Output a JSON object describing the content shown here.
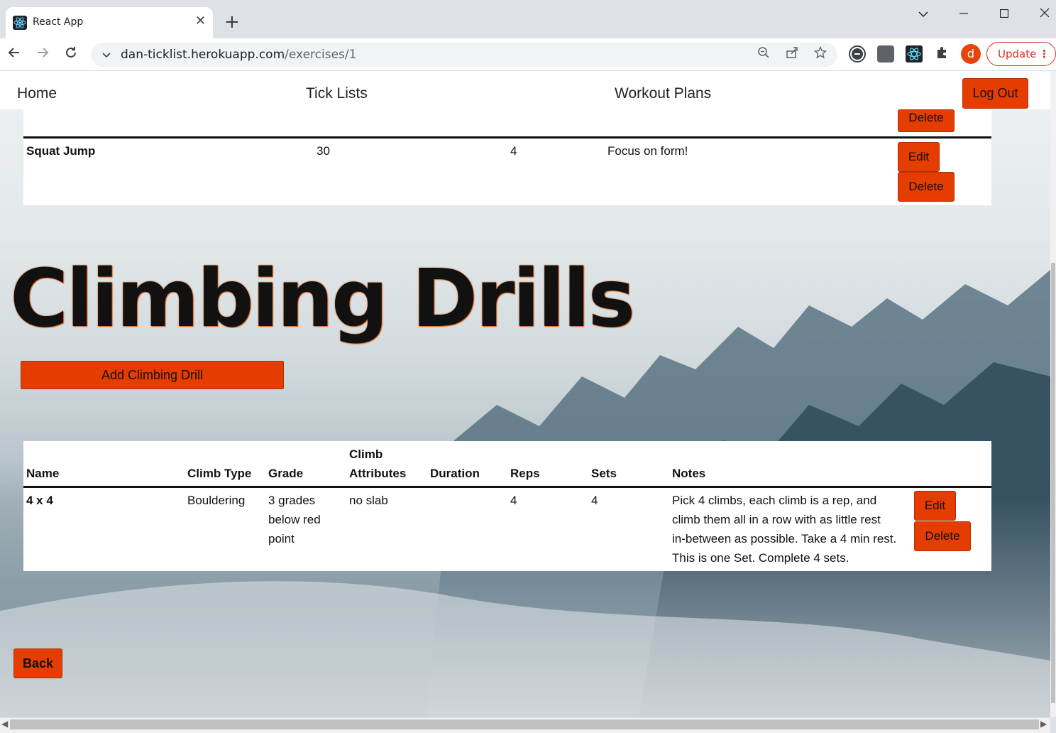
{
  "browser": {
    "tab_title": "React App",
    "tab_close": "✕",
    "new_tab": "+",
    "url_host": "dan-ticklist.herokuapp.com",
    "url_path": "/exercises/1",
    "profile_initial": "d",
    "update_label": "Update",
    "more_label": "⋮"
  },
  "nav": {
    "home": "Home",
    "tick_lists": "Tick Lists",
    "workout_plans": "Workout Plans",
    "logout": "Log Out"
  },
  "exercise_table": {
    "delete_label": "Delete",
    "edit_label": "Edit",
    "row": {
      "name": "Squat Jump",
      "reps": "30",
      "sets": "4",
      "notes": "Focus on form!"
    }
  },
  "drills": {
    "heading": "Climbing Drills",
    "add_button": "Add Climbing Drill",
    "headers": [
      "Name",
      "Climb Type",
      "Grade",
      "Climb",
      "Attributes",
      "Duration",
      "Reps",
      "Sets",
      "Notes"
    ],
    "row": {
      "name": "4 x 4",
      "climb_type": "Bouldering",
      "grade_lines": [
        "3 grades",
        "below red",
        "point"
      ],
      "attributes": "no slab",
      "duration": "",
      "reps": "4",
      "sets": "4",
      "notes_lines": [
        "Pick 4 climbs, each climb is a rep, and",
        "climb them all in a row with as little rest",
        "in-between as possible. Take a 4 min rest.",
        "This is one Set. Complete 4 sets."
      ]
    },
    "edit_label": "Edit",
    "delete_label": "Delete"
  },
  "back_button": "Back",
  "colors": {
    "accent": "#e53d00",
    "chrome": "#dee1e6"
  }
}
